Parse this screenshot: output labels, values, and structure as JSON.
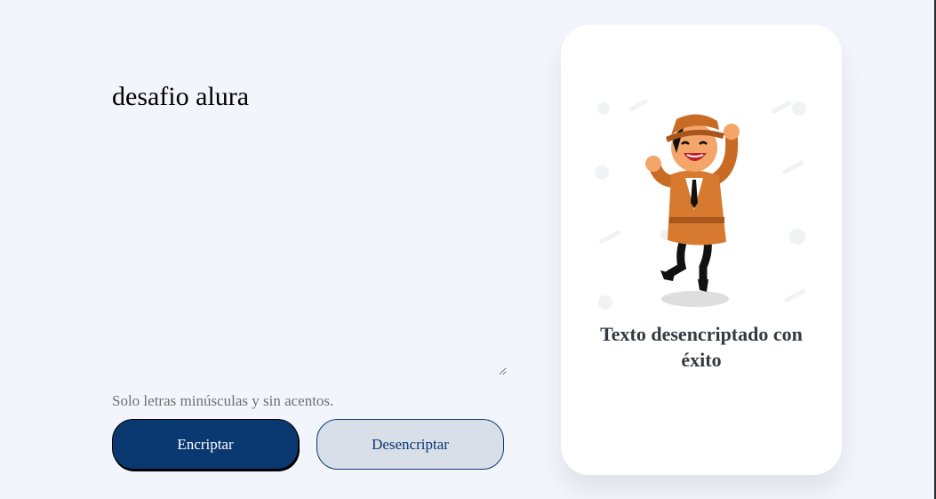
{
  "input": {
    "value": "desafio alura"
  },
  "hint": {
    "text": "Solo letras minúsculas y sin acentos."
  },
  "buttons": {
    "encrypt_label": "Encriptar",
    "decrypt_label": "Desencriptar"
  },
  "result_card": {
    "illustration": "happy-detective-icon",
    "message": "Texto desencriptado con éxito"
  },
  "colors": {
    "page_background": "#f3f5fc",
    "primary": "#0a3871",
    "secondary_button": "#d8dfe8",
    "card_background": "#ffffff",
    "message_text": "#343a40",
    "hint_text": "#6f6f6f"
  }
}
